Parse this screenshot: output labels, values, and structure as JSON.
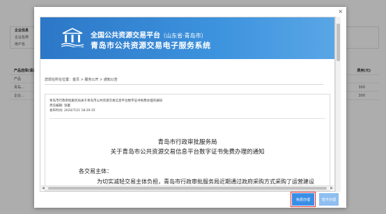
{
  "background": {
    "section1": {
      "title": "企业信息",
      "rows": [
        "企业名称",
        "用户名"
      ]
    },
    "section2": {
      "title": "产品选择(请选择您要办理的产品)",
      "header_left": "产品",
      "header_right": "费用(元)",
      "rows": [
        {
          "label": "青岛...",
          "value": "300"
        },
        {
          "label": "企业...",
          "value": "300"
        }
      ]
    }
  },
  "modal": {
    "close_label": "×",
    "banner": {
      "title_main": "全国公共资源交易平台",
      "title_region": "（山东省·青岛市）",
      "subtitle": "青岛市公共资源交易电子服务系统"
    },
    "breadcrumb": "您现在所在位置：首页 > 服务公开 > 通知公告",
    "document": {
      "meta_title": "青岛市行政审批服务局关于青岛市公共资源交易信息平台数字证书免费办理的通知",
      "meta_editor": "责任编辑: 张蕾",
      "meta_date": "发布时间: 2020/7/21 18:29:35",
      "issuer": "青岛市行政审批服务局",
      "title": "关于青岛市公共资源交易信息平台数字证书免费办理的通知",
      "greeting": "各交易主体：",
      "body_start": "为切实减轻交易主体负担，青岛市行政审批服务局近期通过政府采购方式采购了运营建设"
    },
    "buttons": {
      "free": "免费办理",
      "later": "暂不办理"
    }
  }
}
